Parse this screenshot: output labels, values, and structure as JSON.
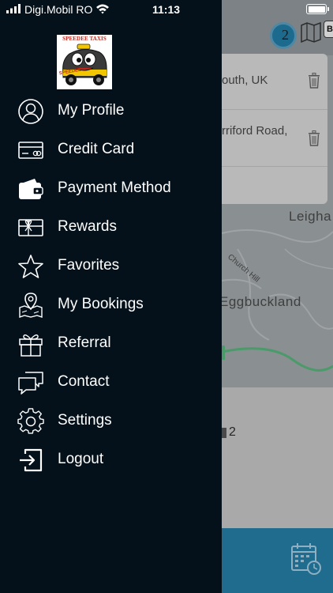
{
  "status_bar": {
    "carrier": "Digi.Mobil RO",
    "time": "11:13",
    "battery_level": 1.0
  },
  "logo": {
    "title": "SPEEDEE TAXIS",
    "badge_text": "SPEEDEE"
  },
  "menu": {
    "items": [
      {
        "label": "My Profile",
        "icon": "person-circle-icon"
      },
      {
        "label": "Credit Card",
        "icon": "credit-card-icon"
      },
      {
        "label": "Payment Method",
        "icon": "wallet-icon"
      },
      {
        "label": "Rewards",
        "icon": "gift-card-icon"
      },
      {
        "label": "Favorites",
        "icon": "star-icon"
      },
      {
        "label": "My Bookings",
        "icon": "map-pin-icon"
      },
      {
        "label": "Referral",
        "icon": "gift-box-icon"
      },
      {
        "label": "Contact",
        "icon": "chat-bubbles-icon"
      },
      {
        "label": "Settings",
        "icon": "gear-icon"
      },
      {
        "label": "Logout",
        "icon": "logout-icon"
      }
    ]
  },
  "background": {
    "pin_number": "2",
    "badge_letter": "B",
    "address_1": "outh, UK",
    "address_2": "rriford Road,",
    "place_1": "Leigha",
    "place_2": "Eggbuckland",
    "street": "Church Hill",
    "passenger_count": "2"
  },
  "colors": {
    "drawer_bg": "#04111a",
    "bottom_bar": "#1f6c8e",
    "text": "#ffffff"
  }
}
